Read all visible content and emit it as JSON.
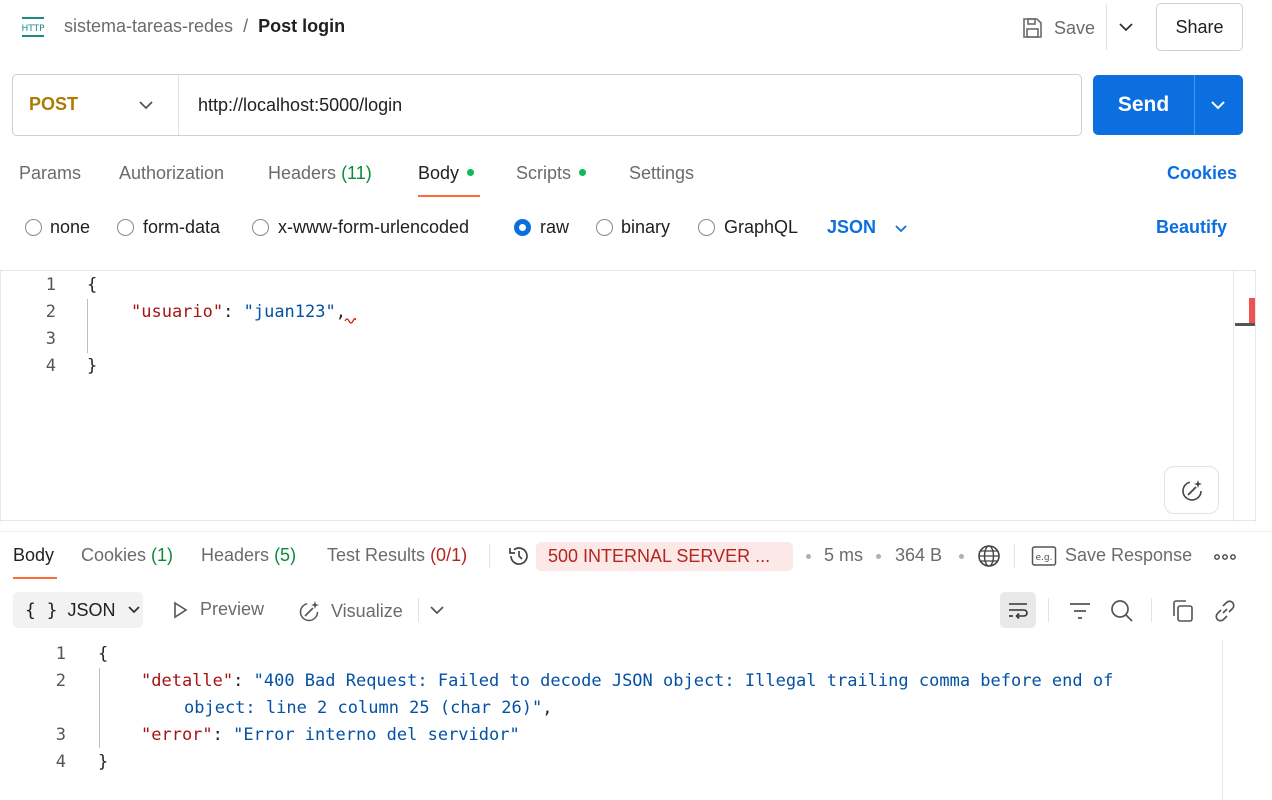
{
  "header": {
    "collection": "sistema-tareas-redes",
    "separator": "/",
    "request_name": "Post login",
    "save_label": "Save",
    "share_label": "Share",
    "http_icon_text": "HTTP"
  },
  "request": {
    "method": "POST",
    "url": "http://localhost:5000/login",
    "send_label": "Send"
  },
  "request_tabs": {
    "params": "Params",
    "authorization": "Authorization",
    "headers": "Headers",
    "headers_count": "(11)",
    "body": "Body",
    "scripts": "Scripts",
    "settings": "Settings",
    "cookies": "Cookies",
    "active": "Body"
  },
  "body_types": {
    "none": "none",
    "form_data": "form-data",
    "urlencoded": "x-www-form-urlencoded",
    "raw": "raw",
    "binary": "binary",
    "graphql": "GraphQL",
    "selected": "raw",
    "language": "JSON",
    "beautify": "Beautify"
  },
  "request_body": {
    "line_numbers": [
      "1",
      "2",
      "3",
      "4"
    ],
    "open_brace": "{",
    "key": "\"usuario\"",
    "colon": ": ",
    "value": "\"juan123\"",
    "comma": ",",
    "close_brace": "}"
  },
  "response_tabs": {
    "body": "Body",
    "cookies": "Cookies",
    "cookies_count": "(1)",
    "headers": "Headers",
    "headers_count": "(5)",
    "tests": "Test Results",
    "tests_count": "(0/1)",
    "active": "Body"
  },
  "response_meta": {
    "status": "500 INTERNAL SERVER ...",
    "time": "5 ms",
    "size": "364 B",
    "save_response": "Save Response",
    "status_color": "#b3261e",
    "status_bg": "#fde8e8"
  },
  "response_toolbar": {
    "format_braces": "{ }",
    "format": "JSON",
    "preview": "Preview",
    "visualize": "Visualize"
  },
  "response_body": {
    "line_numbers": [
      "1",
      "2",
      "3",
      "4"
    ],
    "open_brace": "{",
    "detalle_key": "\"detalle\"",
    "detalle_value_1": "\"400 Bad Request: Failed to decode JSON object: Illegal trailing comma before end of",
    "detalle_value_2": "object: line 2 column 25 (char 26)\"",
    "error_key": "\"error\"",
    "error_value": "\"Error interno del servidor\"",
    "colon": ": ",
    "comma": ",",
    "close_brace": "}"
  },
  "colors": {
    "accent": "#0c6fe0",
    "tab_underline": "#ff6c37",
    "method": "#ad7a03",
    "json_key": "#a31515",
    "json_string": "#0451a5",
    "dot_green": "#0cbb52"
  }
}
